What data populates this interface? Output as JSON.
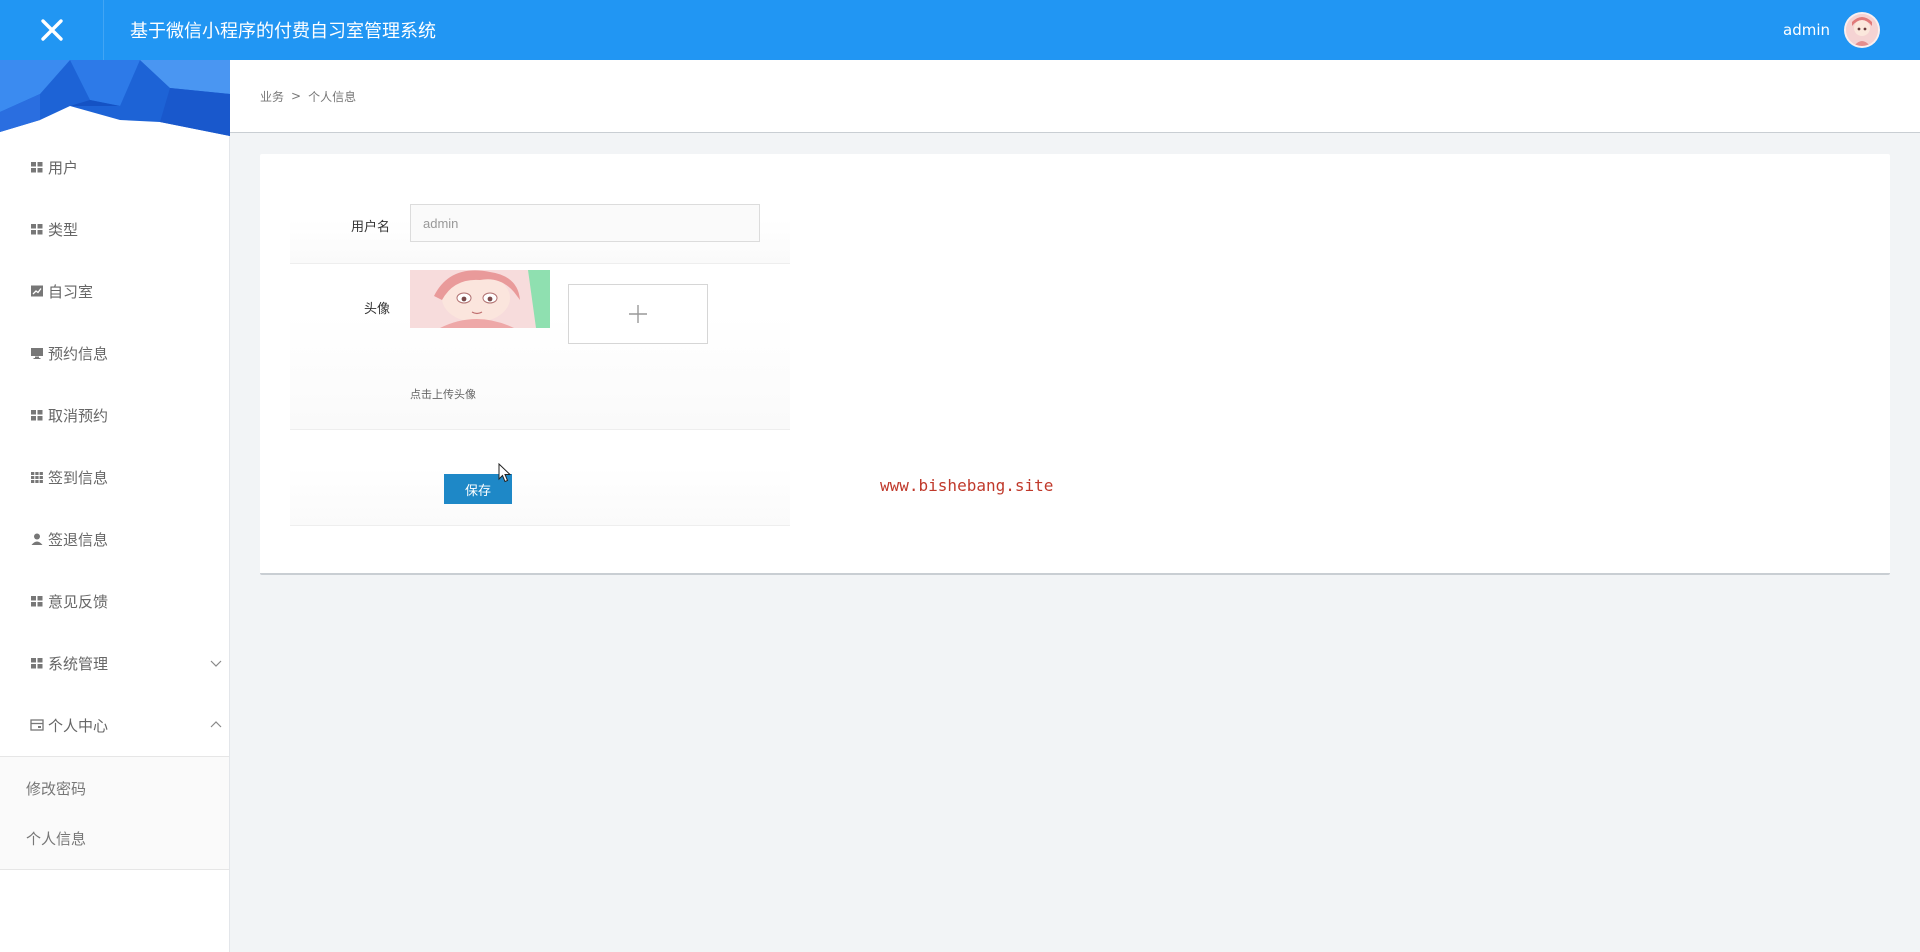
{
  "header": {
    "app_title": "基于微信小程序的付费自习室管理系统",
    "user_name": "admin"
  },
  "sidebar": {
    "items": [
      {
        "label": "用户",
        "icon": "grid-icon"
      },
      {
        "label": "类型",
        "icon": "grid-icon"
      },
      {
        "label": "自习室",
        "icon": "chart-icon"
      },
      {
        "label": "预约信息",
        "icon": "monitor-icon"
      },
      {
        "label": "取消预约",
        "icon": "grid-icon"
      },
      {
        "label": "签到信息",
        "icon": "table-icon"
      },
      {
        "label": "签退信息",
        "icon": "user-icon"
      },
      {
        "label": "意见反馈",
        "icon": "grid-icon"
      },
      {
        "label": "系统管理",
        "icon": "grid-icon",
        "expanded": false
      },
      {
        "label": "个人中心",
        "icon": "card-icon",
        "expanded": true
      }
    ],
    "submenu": [
      {
        "label": "修改密码"
      },
      {
        "label": "个人信息"
      }
    ]
  },
  "breadcrumb": {
    "parent": "业务",
    "separator": ">",
    "current": "个人信息"
  },
  "form": {
    "username_label": "用户名",
    "username_value": "admin",
    "avatar_label": "头像",
    "upload_hint": "点击上传头像",
    "save_label": "保存"
  },
  "watermark": "www.bishebang.site",
  "colors": {
    "header": "#2196f3",
    "primary_button": "#1e88c7",
    "watermark": "#c0392b"
  }
}
